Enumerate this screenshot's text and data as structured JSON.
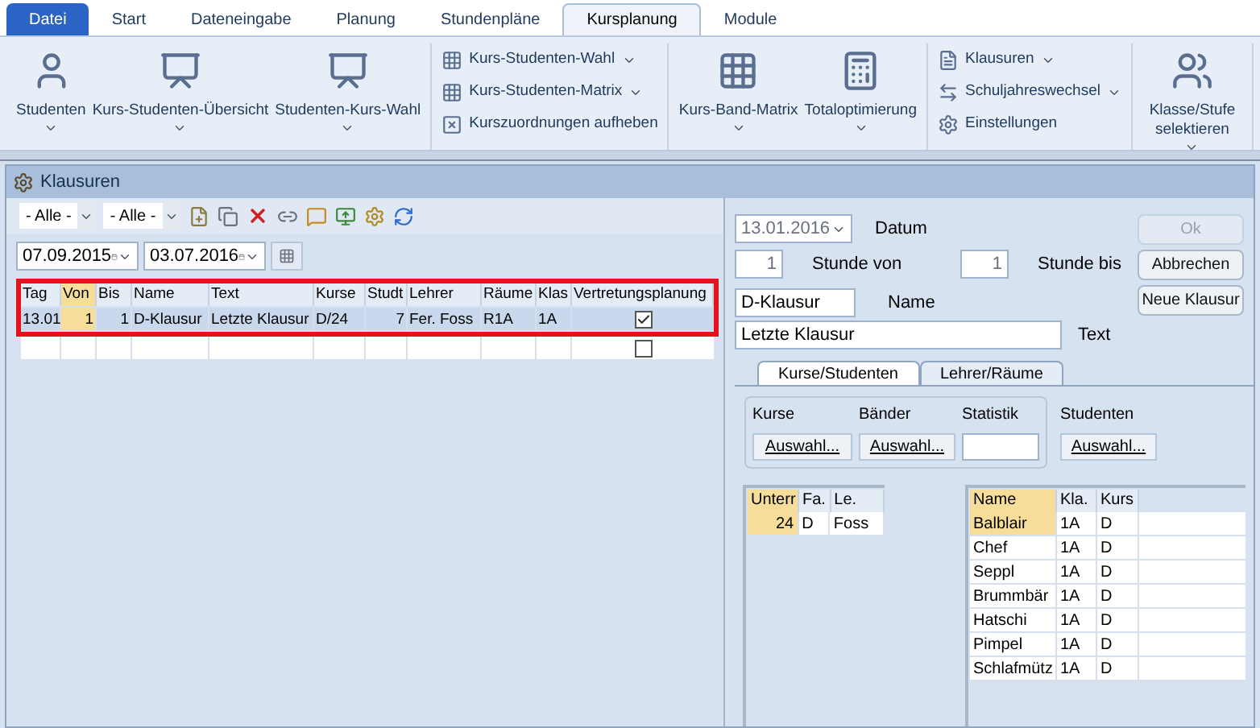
{
  "ribbon_tabs": [
    {
      "label": "Datei",
      "kind": "file",
      "selected": false
    },
    {
      "label": "Start",
      "kind": "tab",
      "selected": false
    },
    {
      "label": "Dateneingabe",
      "kind": "tab",
      "selected": false
    },
    {
      "label": "Planung",
      "kind": "tab",
      "selected": false
    },
    {
      "label": "Stundenpläne",
      "kind": "tab",
      "selected": false
    },
    {
      "label": "Kursplanung",
      "kind": "tab",
      "selected": true
    },
    {
      "label": "Module",
      "kind": "tab",
      "selected": false
    }
  ],
  "ribbon_groups": [
    {
      "items": [
        {
          "kind": "large",
          "label": "Studenten",
          "dropdown": true
        },
        {
          "kind": "large",
          "label": "Kurs-Studenten-Übersicht",
          "dropdown": true
        },
        {
          "kind": "large",
          "label": "Studenten-Kurs-Wahl",
          "dropdown": true
        }
      ]
    },
    {
      "items": [
        {
          "kind": "small",
          "label": "Kurs-Studenten-Wahl",
          "dropdown": true
        },
        {
          "kind": "small",
          "label": "Kurs-Studenten-Matrix",
          "dropdown": true
        },
        {
          "kind": "small",
          "label": "Kurszuordnungen aufheben",
          "dropdown": false
        }
      ]
    },
    {
      "items": [
        {
          "kind": "large",
          "label": "Kurs-Band-Matrix",
          "dropdown": true
        },
        {
          "kind": "large",
          "label": "Totaloptimierung",
          "dropdown": true
        }
      ]
    },
    {
      "items": [
        {
          "kind": "small",
          "label": "Klausuren",
          "dropdown": true
        },
        {
          "kind": "small",
          "label": "Schuljahreswechsel",
          "dropdown": true
        },
        {
          "kind": "small",
          "label": "Einstellungen",
          "dropdown": false
        }
      ]
    },
    {
      "items": [
        {
          "kind": "large-narrow",
          "label": "Klasse/Stufe selektieren",
          "dropdown": true
        }
      ]
    }
  ],
  "window": {
    "title": "Klausuren"
  },
  "filters": [
    "- Alle -",
    "- Alle -"
  ],
  "date_from": "07.09.2015",
  "date_to": "03.07.2016",
  "table": {
    "columns": [
      "Tag",
      "Von",
      "Bis",
      "Name",
      "Text",
      "Kurse",
      "Studt",
      "Lehrer",
      "Räume",
      "Klas",
      "Vertretungsplanung"
    ],
    "rows": [
      {
        "selected": true,
        "cells": [
          "13.01",
          "1",
          "1",
          "D-Klausur",
          "Letzte Klausur",
          "D/24",
          "7",
          "Fer. Foss",
          "R1A",
          "1A"
        ],
        "checked": true
      },
      {
        "selected": false,
        "cells": [],
        "checked": false
      }
    ]
  },
  "form": {
    "date": "13.01.2016",
    "date_label": "Datum",
    "from_value": "1",
    "from_label": "Stunde von",
    "to_value": "1",
    "to_label": "Stunde bis",
    "name_value": "D-Klausur",
    "name_label": "Name",
    "text_value": "Letzte Klausur",
    "text_label": "Text",
    "buttons": [
      {
        "label": "Ok",
        "disabled": true
      },
      {
        "label": "Abbrechen",
        "disabled": false
      },
      {
        "label": "Neue Klausur",
        "disabled": false
      }
    ]
  },
  "detail_tabs": [
    {
      "label": "Kurse/Studenten",
      "selected": true
    },
    {
      "label": "Lehrer/Räume",
      "selected": false
    }
  ],
  "selection": {
    "kurse_label": "Kurse",
    "kurse_button": "Auswahl...",
    "baender_label": "Bänder",
    "baender_button": "Auswahl...",
    "statistik_label": "Statistik",
    "studenten_label": "Studenten",
    "studenten_button": "Auswahl..."
  },
  "courses": {
    "columns": [
      "Unterr",
      "Fa.",
      "Le."
    ],
    "rows": [
      [
        "24",
        "D",
        "Foss"
      ]
    ]
  },
  "students": {
    "columns": [
      "Name",
      "Kla.",
      "Kurs"
    ],
    "rows": [
      [
        "Balblair",
        "1A",
        "D"
      ],
      [
        "Chef",
        "1A",
        "D"
      ],
      [
        "Seppl",
        "1A",
        "D"
      ],
      [
        "Brummbär",
        "1A",
        "D"
      ],
      [
        "Hatschi",
        "1A",
        "D"
      ],
      [
        "Pimpel",
        "1A",
        "D"
      ],
      [
        "Schlafmütz",
        "1A",
        "D"
      ]
    ]
  }
}
